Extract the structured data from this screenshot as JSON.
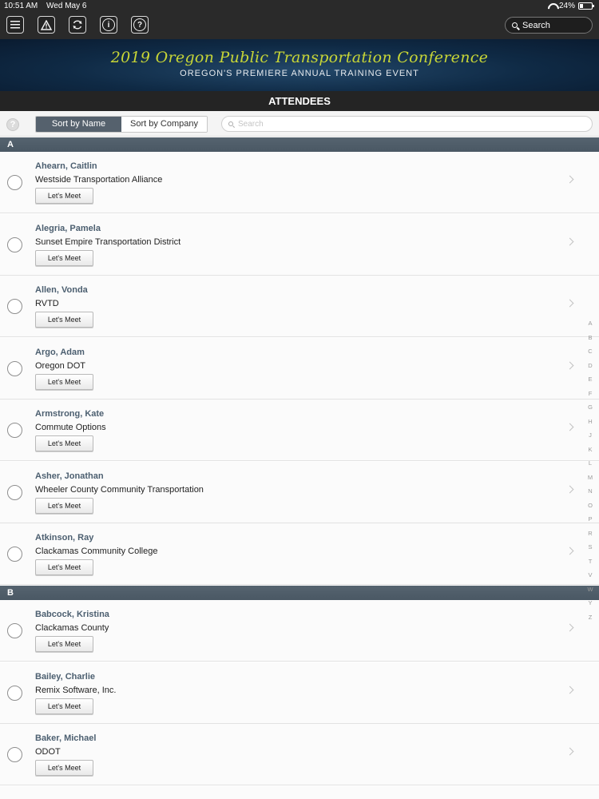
{
  "status": {
    "time": "10:51 AM",
    "date": "Wed May 6",
    "battery": "24%"
  },
  "toolbar": {
    "search_label": "Search"
  },
  "banner": {
    "title": "2019 Oregon Public Transportation Conference",
    "subtitle": "OREGON'S PREMIERE ANNUAL TRAINING EVENT"
  },
  "page": {
    "title": "ATTENDEES"
  },
  "filter": {
    "sort_name": "Sort by Name",
    "sort_company": "Sort by Company",
    "search_placeholder": "Search",
    "help": "?"
  },
  "sections": [
    {
      "letter": "A",
      "rows": [
        {
          "name": "Ahearn, Caitlin",
          "company": "Westside Transportation Alliance",
          "button": "Let's Meet"
        },
        {
          "name": "Alegria, Pamela",
          "company": "Sunset Empire Transportation District",
          "button": "Let's Meet"
        },
        {
          "name": "Allen, Vonda",
          "company": "RVTD",
          "button": "Let's Meet"
        },
        {
          "name": "Argo, Adam",
          "company": "Oregon DOT",
          "button": "Let's Meet"
        },
        {
          "name": "Armstrong, Kate",
          "company": "Commute Options",
          "button": "Let's Meet"
        },
        {
          "name": "Asher, Jonathan",
          "company": "Wheeler County Community Transportation",
          "button": "Let's Meet"
        },
        {
          "name": "Atkinson, Ray",
          "company": "Clackamas Community College",
          "button": "Let's Meet"
        }
      ]
    },
    {
      "letter": "B",
      "rows": [
        {
          "name": "Babcock, Kristina",
          "company": "Clackamas County",
          "button": "Let's Meet"
        },
        {
          "name": "Bailey, Charlie",
          "company": "Remix Software, Inc.",
          "button": "Let's Meet"
        },
        {
          "name": "Baker, Michael",
          "company": "ODOT",
          "button": "Let's Meet"
        }
      ]
    }
  ],
  "index_letters": [
    "A",
    "B",
    "C",
    "D",
    "E",
    "F",
    "G",
    "H",
    "J",
    "K",
    "L",
    "M",
    "N",
    "O",
    "P",
    "R",
    "S",
    "T",
    "V",
    "W",
    "Y",
    "Z"
  ]
}
